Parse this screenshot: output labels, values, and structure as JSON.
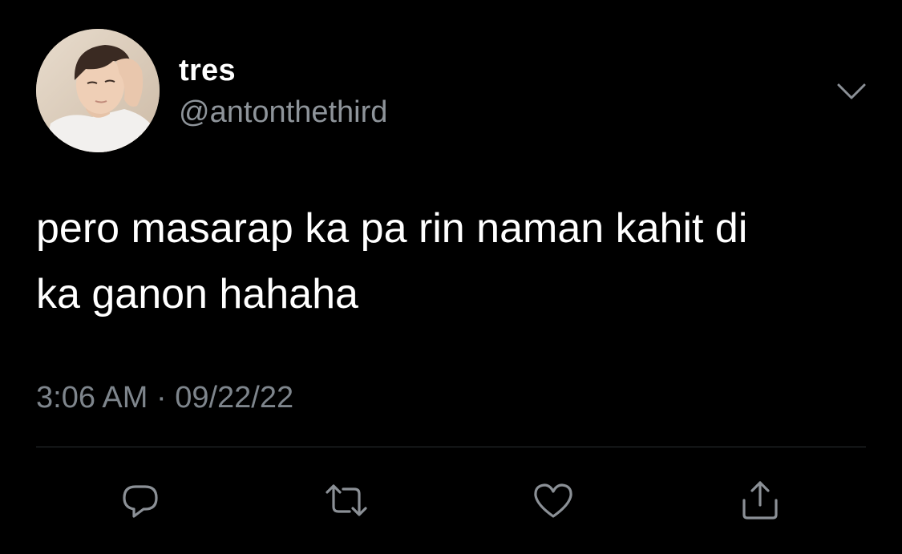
{
  "tweet": {
    "author": {
      "display_name": "tres",
      "handle": "@antonthethird"
    },
    "text_lines": [
      "pero masarap ka pa rin naman kahit di",
      "ka ganon hahaha"
    ],
    "time": "3:06 AM",
    "separator": "·",
    "date": "09/22/22"
  },
  "actions": [
    {
      "name": "reply",
      "icon": "reply-icon"
    },
    {
      "name": "retweet",
      "icon": "retweet-icon"
    },
    {
      "name": "like",
      "icon": "heart-icon"
    },
    {
      "name": "share",
      "icon": "share-icon"
    }
  ],
  "colors": {
    "background": "#000000",
    "primary_text": "#ffffff",
    "secondary_text": "#8e949a",
    "icon": "#8b9096",
    "divider": "#2b2f33"
  }
}
